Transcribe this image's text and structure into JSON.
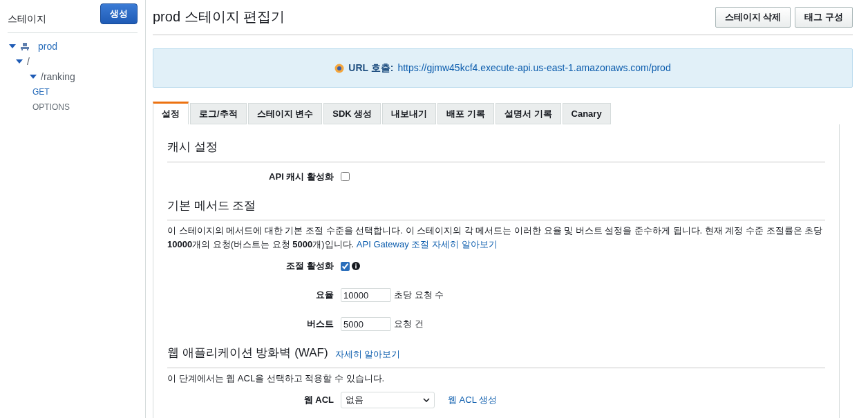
{
  "sidebar": {
    "title": "스테이지",
    "create_button": "생성",
    "tree": [
      {
        "kind": "stage",
        "label": "prod",
        "expanded": true,
        "children": [
          {
            "kind": "resource",
            "label": "/",
            "expanded": true,
            "children": [
              {
                "kind": "resource",
                "label": "/ranking",
                "expanded": true,
                "children": [
                  {
                    "kind": "method",
                    "label": "GET",
                    "selected": true
                  },
                  {
                    "kind": "method",
                    "label": "OPTIONS",
                    "selected": false
                  }
                ]
              }
            ]
          }
        ]
      }
    ]
  },
  "header": {
    "title": "prod 스테이지 편집기",
    "buttons": [
      "스테이지 삭제",
      "태그 구성"
    ]
  },
  "invoke_url": {
    "label": "URL 호출:",
    "url": "https://gjmw45kcf4.execute-api.us-east-1.amazonaws.com/prod"
  },
  "tabs": [
    {
      "label": "설정",
      "selected": true
    },
    {
      "label": "로그/추적",
      "selected": false
    },
    {
      "label": "스테이지 변수",
      "selected": false
    },
    {
      "label": "SDK 생성",
      "selected": false
    },
    {
      "label": "내보내기",
      "selected": false
    },
    {
      "label": "배포 기록",
      "selected": false
    },
    {
      "label": "설명서 기록",
      "selected": false
    },
    {
      "label": "Canary",
      "selected": false
    }
  ],
  "sections": [
    {
      "title": "캐시 설정",
      "fields": [
        {
          "kind": "checkbox",
          "label": "API 캐시 활성화",
          "checked": false,
          "info": false
        }
      ]
    },
    {
      "title": "기본 메서드 조절",
      "description": "이 스테이지의 메서드에 대한 기본 조절 수준을 선택합니다. 이 스테이지의 각 메서드는 이러한 요율 및 버스트 설정을 준수하게 됩니다. 현재 계정 수준 조절률은 초당 **10000**개의 요청(버스트는 요청 **5000**개)입니다.",
      "description_link": "API Gateway 조절 자세히 알아보기",
      "fields": [
        {
          "kind": "checkbox",
          "label": "조절 활성화",
          "checked": true,
          "info": true
        },
        {
          "kind": "number",
          "label": "요율",
          "value": "10000",
          "unit": "초당 요청 수"
        },
        {
          "kind": "number",
          "label": "버스트",
          "value": "5000",
          "unit": "요청 건"
        }
      ]
    },
    {
      "title": "웹 애플리케이션 방화벽 (WAF)",
      "title_link": "자세히 알아보기",
      "description": "이 단계에서는 웹 ACL을 선택하고 적용할 수 있습니다.",
      "fields": [
        {
          "kind": "select",
          "label": "웹 ACL",
          "value": "없음",
          "link": "웹 ACL 생성"
        }
      ]
    }
  ]
}
